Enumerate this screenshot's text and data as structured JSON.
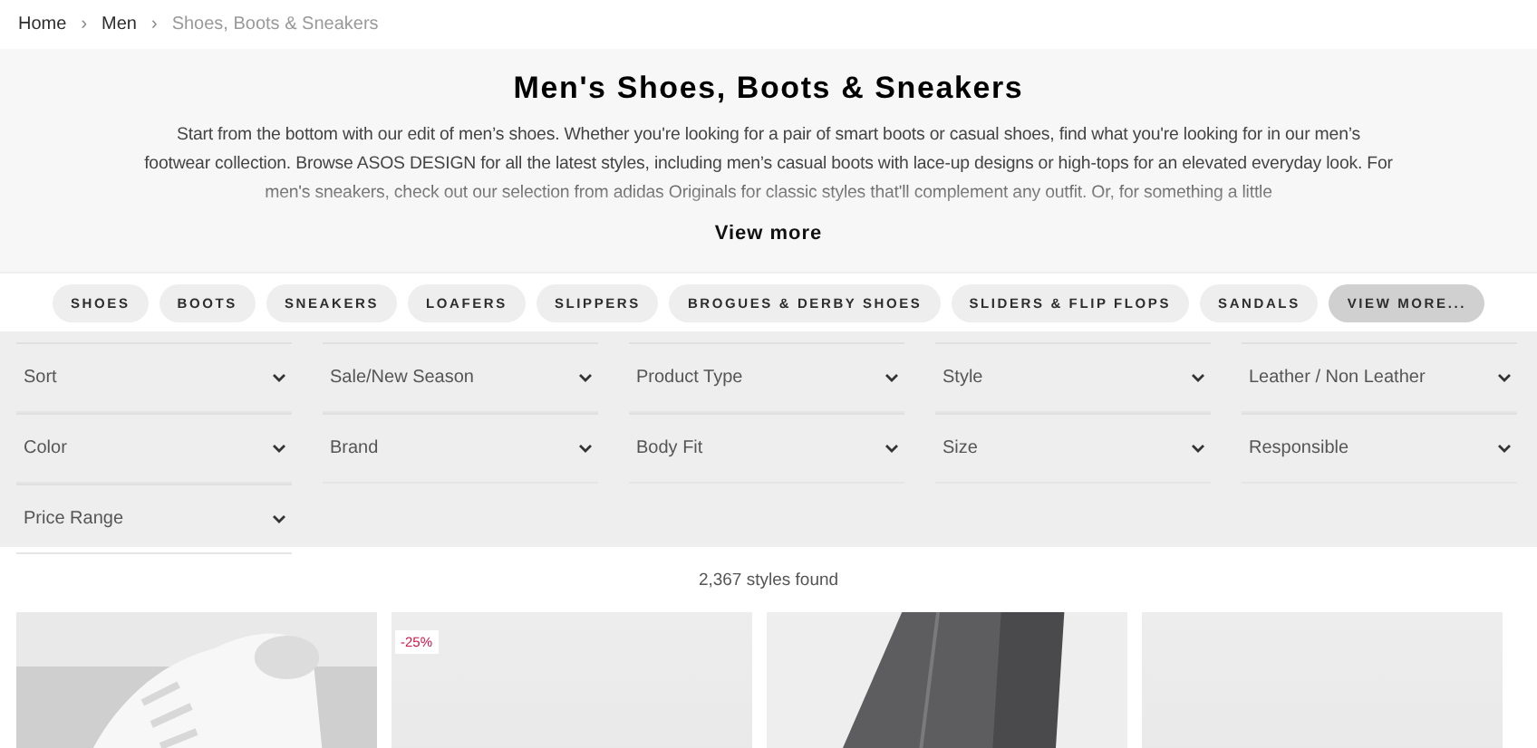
{
  "breadcrumb": [
    {
      "label": "Home",
      "current": false
    },
    {
      "label": "Men",
      "current": false
    },
    {
      "label": "Shoes, Boots & Sneakers",
      "current": true
    }
  ],
  "breadcrumb_separator": "›",
  "hero": {
    "title": "Men's Shoes, Boots & Sneakers",
    "description": "Start from the bottom with our edit of men’s shoes. Whether you're looking for a pair of smart boots or casual shoes, find what you're looking for in our men’s footwear collection. Browse ASOS DESIGN for all the latest styles, including men’s casual boots with lace-up designs or high-tops for an elevated everyday look. For men's sneakers, check out our selection from adidas Originals for classic styles that'll complement any outfit. Or, for something a little",
    "view_more": "View more"
  },
  "categories": [
    {
      "label": "SHOES",
      "kind": "category"
    },
    {
      "label": "BOOTS",
      "kind": "category"
    },
    {
      "label": "SNEAKERS",
      "kind": "category"
    },
    {
      "label": "LOAFERS",
      "kind": "category"
    },
    {
      "label": "SLIPPERS",
      "kind": "category"
    },
    {
      "label": "BROGUES & DERBY SHOES",
      "kind": "category"
    },
    {
      "label": "SLIDERS & FLIP FLOPS",
      "kind": "category"
    },
    {
      "label": "SANDALS",
      "kind": "category"
    },
    {
      "label": "VIEW MORE...",
      "kind": "more"
    }
  ],
  "filters": [
    "Sort",
    "Sale/New Season",
    "Product Type",
    "Style",
    "Leather / Non Leather",
    "Color",
    "Brand",
    "Body Fit",
    "Size",
    "Responsible",
    "Price Range"
  ],
  "results_count": "2,367 styles found",
  "products": [
    {
      "kind": "sneaker"
    },
    {
      "kind": "plain",
      "badge": "-25%"
    },
    {
      "kind": "jeans"
    },
    {
      "kind": "plain"
    }
  ]
}
